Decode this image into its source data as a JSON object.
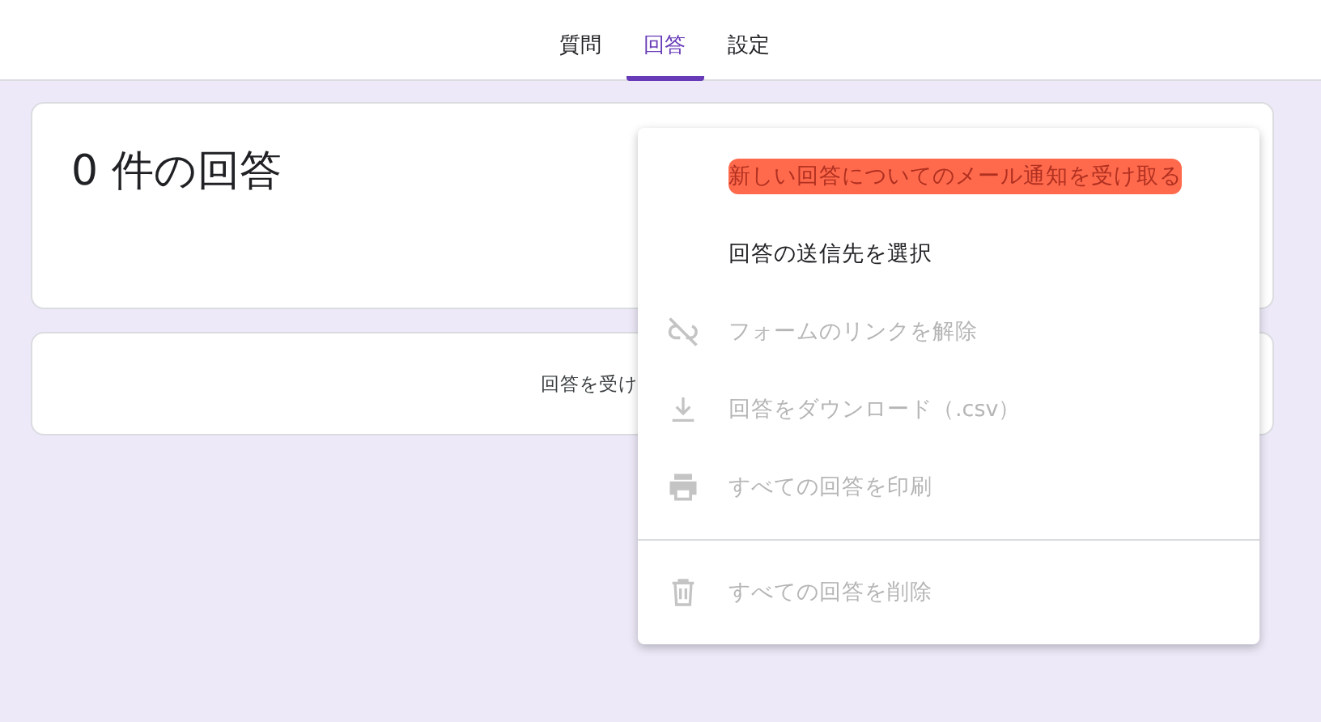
{
  "tabs": [
    {
      "label": "質問",
      "selected": false
    },
    {
      "label": "回答",
      "selected": true
    },
    {
      "label": "設定",
      "selected": false
    }
  ],
  "summary_card": {
    "title": "0 件の回答"
  },
  "status_card": {
    "message": "回答を受け"
  },
  "menu": {
    "items": [
      {
        "label": "新しい回答についてのメール通知を受け取る",
        "kind": "none",
        "disabled": false,
        "highlighted": true
      },
      {
        "label": "回答の送信先を選択",
        "kind": "none",
        "disabled": false,
        "highlighted": false
      },
      {
        "label": "フォームのリンクを解除",
        "kind": "unlink",
        "disabled": true,
        "highlighted": false
      },
      {
        "label": "回答をダウンロード（.csv）",
        "kind": "download",
        "disabled": true,
        "highlighted": false
      },
      {
        "label": "すべての回答を印刷",
        "kind": "print",
        "disabled": true,
        "highlighted": false
      },
      {
        "label": "すべての回答を削除",
        "kind": "delete",
        "disabled": true,
        "highlighted": false,
        "divider_before": true
      }
    ]
  }
}
